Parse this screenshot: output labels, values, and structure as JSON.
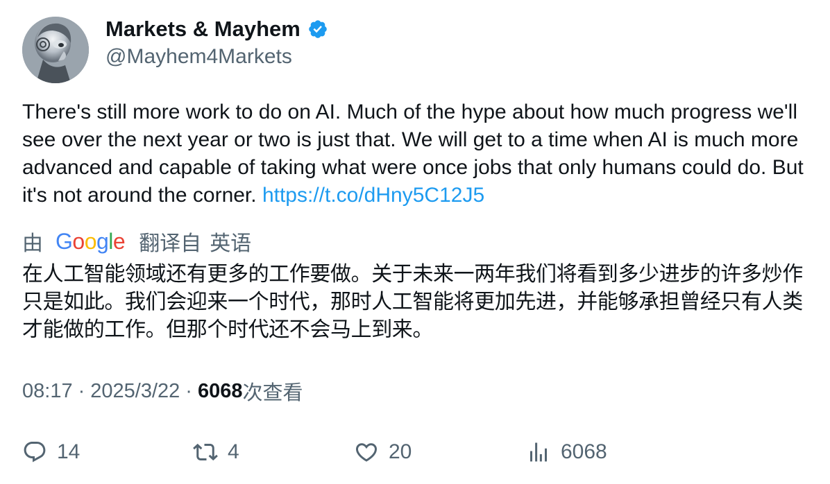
{
  "author": {
    "display_name": "Markets & Mayhem",
    "handle": "@Mayhem4Markets",
    "verified": true,
    "avatar": "robot-avatar"
  },
  "tweet": {
    "text": "There's still more work to do on AI. Much of the hype about how much progress we'll see over the next year or two is just that. We will get to a time when AI is much more advanced and capable of taking what were once jobs that only humans could do. But it's not around the corner.",
    "link": "https://t.co/dHny5C12J5"
  },
  "translation": {
    "by_label": "由",
    "provider": "Google",
    "translated_from": "翻译自",
    "source_language": "英语",
    "text": "在人工智能领域还有更多的工作要做。关于未来一两年我们将看到多少进步的许多炒作只是如此。我们会迎来一个时代，那时人工智能将更加先进，并能够承担曾经只有人类才能做的工作。但那个时代还不会马上到来。"
  },
  "meta": {
    "time": "08:17",
    "separator": "·",
    "date": "2025/3/22",
    "views_count": "6068",
    "views_label": "次查看"
  },
  "actions": {
    "replies": "14",
    "retweets": "4",
    "likes": "20",
    "views": "6068"
  },
  "colors": {
    "text": "#0f1419",
    "secondary": "#536471",
    "link": "#1d9bf0",
    "verified": "#1d9bf0"
  }
}
